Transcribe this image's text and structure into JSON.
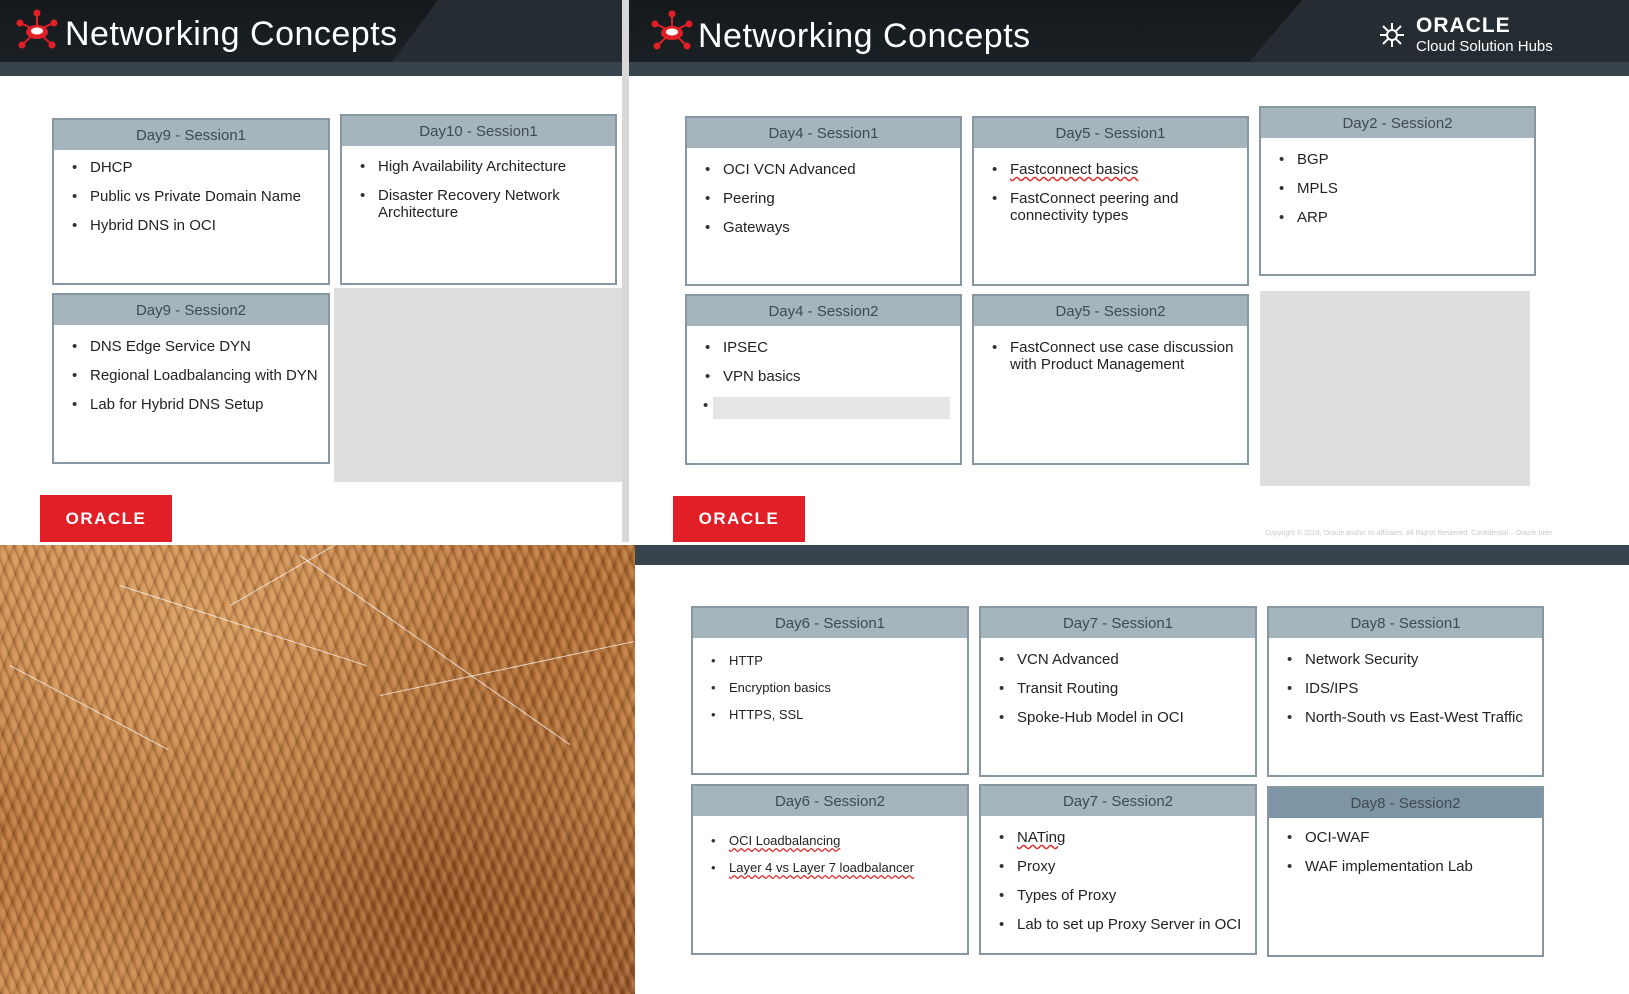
{
  "slides": {
    "left": {
      "title": "Networking Concepts",
      "oracle_logo": "ORACLE",
      "cards": [
        {
          "session": "Day9 - Session1",
          "items": [
            "DHCP",
            "Public vs Private Domain Name",
            "Hybrid DNS in OCI"
          ]
        },
        {
          "session": "Day10 - Session1",
          "items": [
            "High Availability Architecture",
            "Disaster Recovery Network Architecture"
          ]
        },
        {
          "session": "Day9 - Session2",
          "items": [
            "DNS Edge Service DYN",
            "Regional Loadbalancing with DYN",
            "Lab for Hybrid DNS Setup"
          ]
        }
      ]
    },
    "right": {
      "title": "Networking Concepts",
      "brand": {
        "name": "ORACLE",
        "subtitle": "Cloud Solution Hubs"
      },
      "oracle_logo": "ORACLE",
      "copyright": "Copyright © 2019, Oracle and/or its affiliates. All Rights Reserved. Confidential – Oracle Inter",
      "cards": [
        {
          "session": "Day4 - Session1",
          "items": [
            "OCI VCN Advanced",
            "Peering",
            "Gateways"
          ]
        },
        {
          "session": "Day5 - Session1",
          "items": [
            "Fastconnect basics",
            "FastConnect peering and connectivity types"
          ]
        },
        {
          "session": "Day2 - Session2",
          "items": [
            "BGP",
            "MPLS",
            "ARP"
          ]
        },
        {
          "session": "Day4 - Session2",
          "items": [
            "IPSEC",
            "VPN basics"
          ]
        },
        {
          "session": "Day5 - Session2",
          "items": [
            "FastConnect use case discussion with Product Management"
          ]
        }
      ]
    },
    "bottom": {
      "cards": [
        {
          "session": "Day6 - Session1",
          "items": [
            "HTTP",
            "Encryption basics",
            "HTTPS, SSL"
          ]
        },
        {
          "session": "Day7 - Session1",
          "items": [
            "VCN Advanced",
            "Transit Routing",
            "Spoke-Hub Model in OCI"
          ]
        },
        {
          "session": "Day8 - Session1",
          "items": [
            "Network Security",
            "IDS/IPS",
            "North-South vs East-West Traffic"
          ]
        },
        {
          "session": "Day6 - Session2",
          "items": [
            "OCI Loadbalancing",
            "Layer 4 vs Layer 7 loadbalancer"
          ]
        },
        {
          "session": "Day7 - Session2",
          "items": [
            "NATing",
            "Proxy",
            "Types of Proxy",
            "Lab to set up Proxy Server in OCI"
          ]
        },
        {
          "session": "Day8 - Session2",
          "items": [
            "OCI-WAF",
            "WAF implementation Lab"
          ]
        }
      ]
    }
  },
  "icons": {
    "hub_logo": "cloud-hub-icon",
    "brand_mark": "hub-network-icon"
  },
  "colors": {
    "header": "#15191c",
    "card_head": "#a5b4bd",
    "oracle_red": "#e21e26"
  }
}
